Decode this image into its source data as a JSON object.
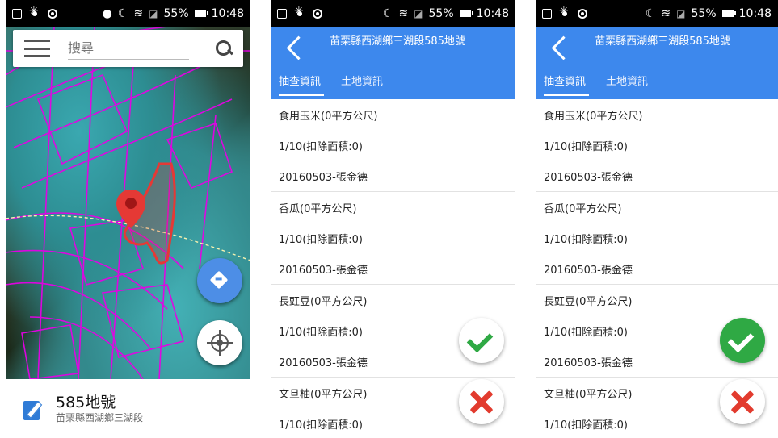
{
  "status_bar": {
    "battery": "55%",
    "time": "10:48"
  },
  "map_screen": {
    "search_placeholder": "搜尋",
    "card_title": "585地號",
    "card_subtitle": "苗栗縣西湖鄉三湖段",
    "colors": {
      "parcel_lines": "#e600e6",
      "marker": "#e53935",
      "fab_blue": "#4d8ee6"
    }
  },
  "detail_screen": {
    "title": "苗栗縣西湖鄉三湖段585地號",
    "tabs": [
      "抽查資訊",
      "土地資訊"
    ],
    "groups": [
      {
        "crop": "食用玉米(0平方公尺)",
        "deduction": "1/10(扣除面積:0)",
        "record": "20160503-張金德"
      },
      {
        "crop": "香瓜(0平方公尺)",
        "deduction": "1/10(扣除面積:0)",
        "record": "20160503-張金德"
      },
      {
        "crop": "長豇豆(0平方公尺)",
        "deduction": "1/10(扣除面積:0)",
        "record": "20160503-張金德"
      },
      {
        "crop": "文旦柚(0平方公尺)",
        "deduction": "1/10(扣除面積:0)"
      }
    ],
    "colors": {
      "appbar": "#3d88ed",
      "check": "#2fa944",
      "cross": "#e23b2e"
    }
  }
}
